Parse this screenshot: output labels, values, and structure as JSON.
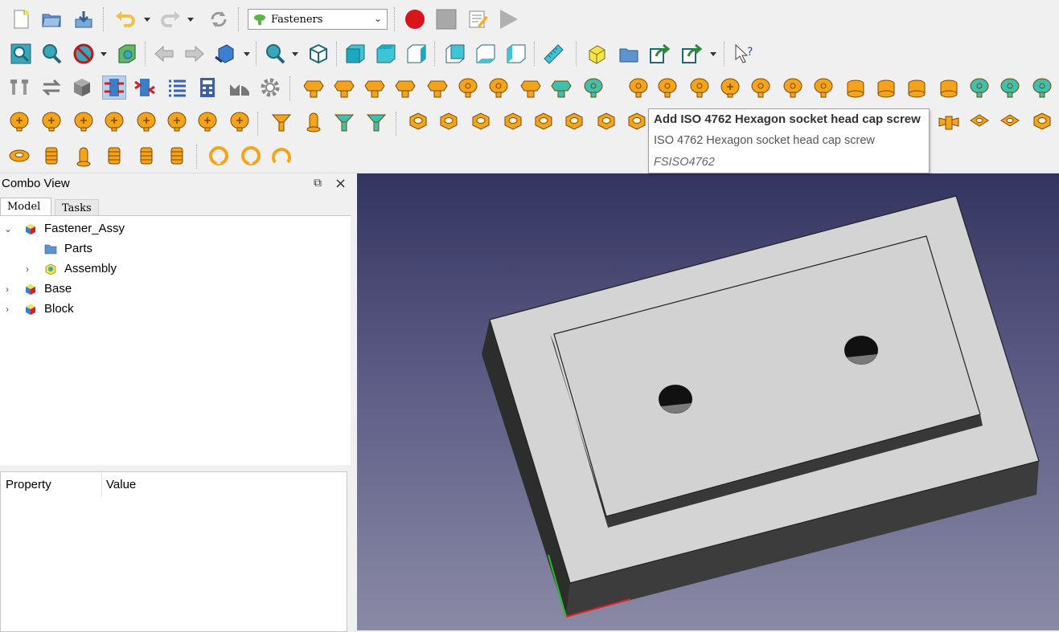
{
  "workbench": {
    "selected": "Fasteners"
  },
  "icons": {
    "row1": [
      "new-document",
      "open-document",
      "save-document",
      "undo",
      "redo",
      "refresh",
      "workbench-selector",
      "record-macro",
      "stop-macro",
      "edit-macro",
      "execute-macro"
    ],
    "row2": [
      "fit-all",
      "fit-selection",
      "draw-style",
      "bounding-box",
      "back",
      "forward",
      "sync-view",
      "std-views",
      "isometric",
      "front",
      "top",
      "right",
      "rear",
      "bottom",
      "left",
      "measure",
      "create-part",
      "create-group",
      "link",
      "link-actions",
      "whats-this"
    ]
  },
  "colors": {
    "screw_orange": "#f5a31a",
    "screw_teal": "#3cc0b0",
    "highlight": "#f27d26",
    "viewport_top": "#343460",
    "viewport_bottom": "#8a8aa6",
    "solid_face": "#d4d4d4"
  },
  "tooltip": {
    "title": "Add ISO 4762 Hexagon socket head cap screw",
    "description": "ISO 4762 Hexagon socket head cap screw",
    "command": "FSISO4762"
  },
  "combo_view": {
    "title": "Combo View",
    "tabs": [
      {
        "label": "Model"
      },
      {
        "label": "Tasks"
      }
    ],
    "tree": [
      {
        "label": "Fastener_Assy",
        "expanded": true,
        "icon": "part-icon"
      },
      {
        "label": "Parts",
        "icon": "folder-icon"
      },
      {
        "label": "Assembly",
        "icon": "assembly-icon"
      },
      {
        "label": "Base",
        "icon": "part-icon"
      },
      {
        "label": "Block",
        "icon": "part-icon"
      }
    ],
    "property_headers": {
      "property": "Property",
      "value": "Value"
    }
  }
}
